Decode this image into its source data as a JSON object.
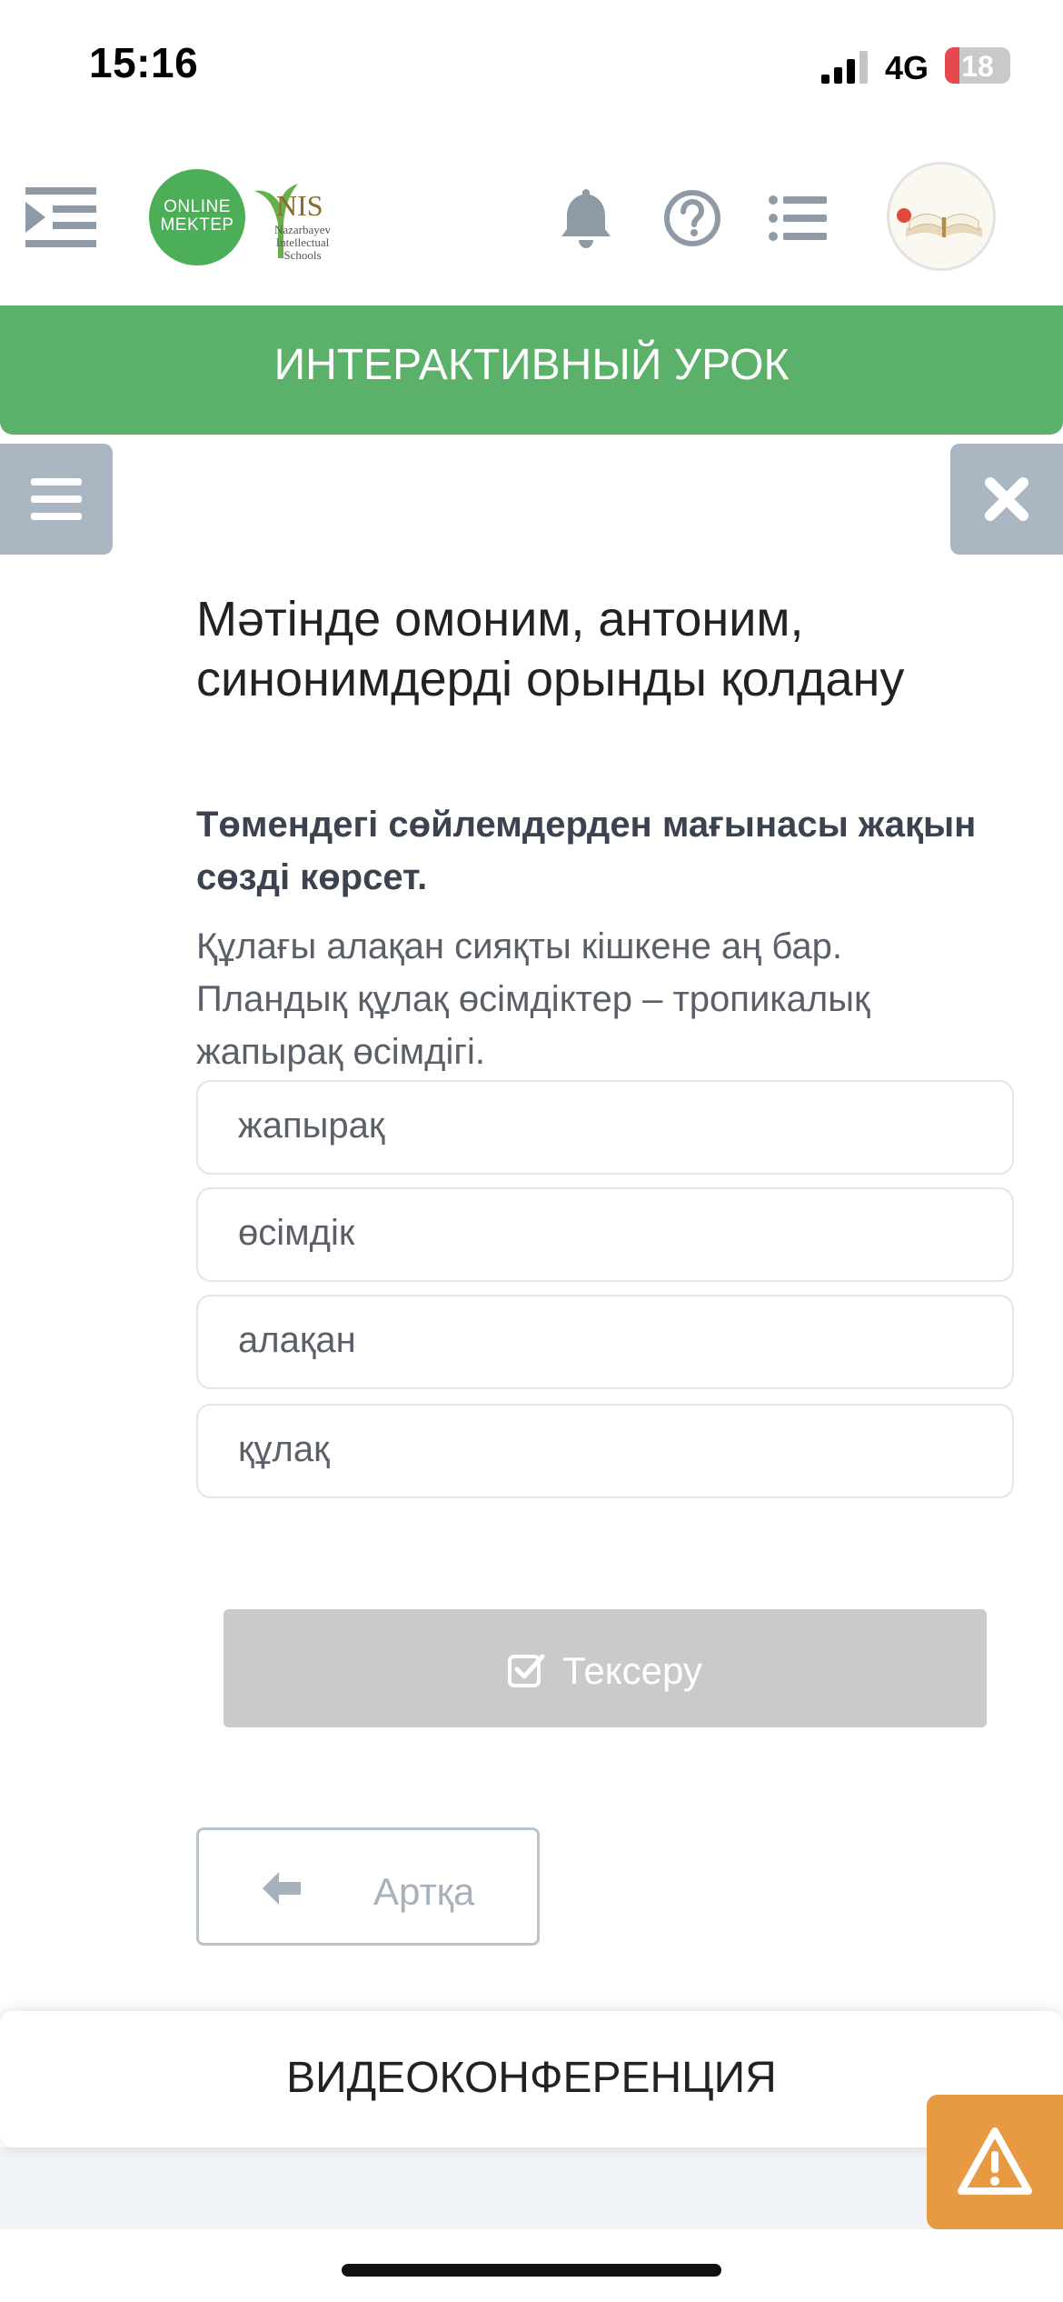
{
  "status_bar": {
    "time": "15:16",
    "network": "4G",
    "battery": "18"
  },
  "header": {
    "logo_online": "ONLINE",
    "logo_mektep": "MEKTEP",
    "nis_title": "NIS",
    "nis_sub": "Nazarbayev Intellectual Schools"
  },
  "banner": {
    "title": "ИНТЕРАКТИВНЫЙ УРОК"
  },
  "lesson": {
    "title": "Мәтінде омоним, антоним, синонимдерді орынды қолдану",
    "instruction": "Төмендегі сөйлемдерден мағынасы жақын сөзді көрсет.",
    "text": "Құлағы алақан сияқты кішкене аң бар. Пландық құлақ өсімдіктер – тропикалық жапырақ өсімдігі.",
    "options": [
      "жапырақ",
      "өсімдік",
      "алақан",
      "құлақ"
    ]
  },
  "actions": {
    "check_label": "Тексеру",
    "back_label": "Артқа"
  },
  "footer": {
    "video_label": "ВИДЕОКОНФЕРЕНЦИЯ"
  },
  "colors": {
    "accent_green": "#5cb16a",
    "logo_green": "#4caf57",
    "toggle_gray": "#aab7c2",
    "warning_orange": "#e89a43"
  }
}
